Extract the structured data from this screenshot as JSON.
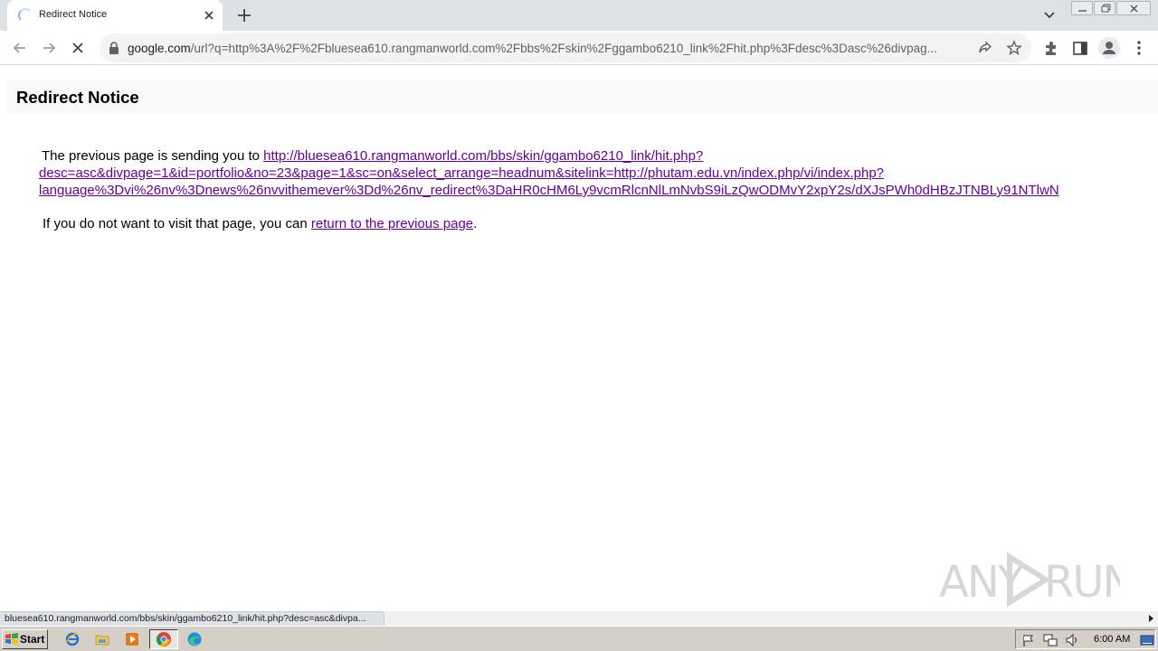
{
  "browser": {
    "tab_title": "Redirect Notice",
    "url_host": "google.com",
    "url_rest": "/url?q=http%3A%2F%2Fbluesea610.rangmanworld.com%2Fbbs%2Fskin%2Fggambo6210_link%2Fhit.php%3Fdesc%3Dasc%26divpag..."
  },
  "page": {
    "title": "Redirect Notice",
    "sending_prefix": "The previous page is sending you to ",
    "link_line1": "http://bluesea610.rangmanworld.com/bbs/skin/ggambo6210_link/hit.php?",
    "link_line2": "desc=asc&divpage=1&id=portfolio&no=23&page=1&sc=on&select_arrange=headnum&sitelink=http://phutam.edu.vn/index.php/vi/index.php?",
    "link_line3": "language%3Dvi%26nv%3Dnews%26nvvithemever%3Dd%26nv_redirect%3DaHR0cHM6Ly9vcmRlcnNlLmNvbS9iLzQwODMvY2xpY2s/dXJsPWh0dHBzJTNBLy91NTlwN",
    "cancel_prefix": "If you do not want to visit that page, you can ",
    "cancel_link": "return to the previous page",
    "cancel_suffix": "."
  },
  "watermark": {
    "left": "ANY",
    "right": "RUN"
  },
  "status": {
    "text": "bluesea610.rangmanworld.com/bbs/skin/ggambo6210_link/hit.php?desc=asc&divpa..."
  },
  "taskbar": {
    "start_label": "Start",
    "clock": "6:00 AM"
  },
  "colors": {
    "visited_link": "#660099",
    "tab_strip": "#dee1e6",
    "omnibox": "#f1f3f4",
    "taskbar": "#d4d0c8"
  }
}
